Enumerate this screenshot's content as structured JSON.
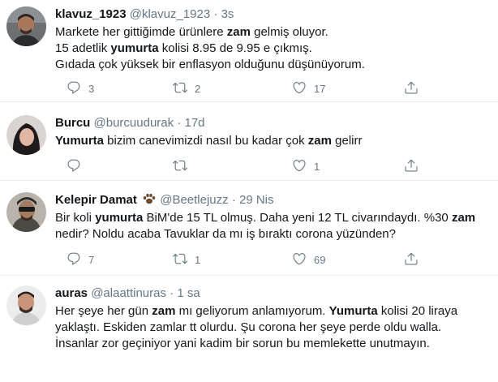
{
  "tweets": [
    {
      "name": "klavuz_1923",
      "handle": "@klavuz_1923",
      "separator": "·",
      "time": "3s",
      "lines": [
        [
          {
            "t": "Markete her gittiğimde ürünlere ",
            "b": false
          },
          {
            "t": "zam",
            "b": true
          },
          {
            "t": " gelmiş oluyor.",
            "b": false
          }
        ],
        [
          {
            "t": "15 adetlik ",
            "b": false
          },
          {
            "t": "yumurta",
            "b": true
          },
          {
            "t": " kolisi 8.95 de 9.95 e çıkmış.",
            "b": false
          }
        ],
        [
          {
            "t": "Gıdada çok yüksek bir enflasyon olduğunu düşünüyorum.",
            "b": false
          }
        ]
      ],
      "replies": "3",
      "retweets": "2",
      "likes": "17"
    },
    {
      "name": "Burcu",
      "handle": "@burcuudurak",
      "separator": "·",
      "time": "17d",
      "lines": [
        [
          {
            "t": "Yumurta",
            "b": true
          },
          {
            "t": " bizim canevimizdi nasıl bu kadar çok ",
            "b": false
          },
          {
            "t": "zam",
            "b": true
          },
          {
            "t": " gelirr",
            "b": false
          }
        ]
      ],
      "replies": "",
      "retweets": "",
      "likes": "1"
    },
    {
      "name": "Kelepir Damat",
      "has_paw": true,
      "handle": "@Beetlejuzz",
      "separator": "·",
      "time": "29 Nis",
      "lines": [
        [
          {
            "t": "Bir koli ",
            "b": false
          },
          {
            "t": "yumurta",
            "b": true
          },
          {
            "t": " BiM'de 15 TL olmuş. Daha yeni 12 TL civarındaydı. %30 ",
            "b": false
          },
          {
            "t": "zam",
            "b": true
          }
        ],
        [
          {
            "t": "nedir? Noldu acaba Tavuklar da mı iş bıraktı corona yüzünden?",
            "b": false
          }
        ]
      ],
      "replies": "7",
      "retweets": "1",
      "likes": "69"
    },
    {
      "name": "auras",
      "handle": "@alaattinuras",
      "separator": "·",
      "time": "1 sa",
      "lines": [
        [
          {
            "t": "Her şeye her gün ",
            "b": false
          },
          {
            "t": "zam",
            "b": true
          },
          {
            "t": " mı geliyorum anlamıyorum. ",
            "b": false
          },
          {
            "t": "Yumurta",
            "b": true
          },
          {
            "t": " kolisi 20 liraya",
            "b": false
          }
        ],
        [
          {
            "t": "yaklaştı. Eskiden zamlar tt olurdu. Şu corona her şeye perde oldu walla.",
            "b": false
          }
        ],
        [
          {
            "t": "İnsanlar zor geçiniyor yani kadim bir sorun bu memlekette unutmayın.",
            "b": false
          }
        ]
      ],
      "replies": "",
      "retweets": "",
      "likes": ""
    }
  ],
  "icons": {
    "reply": "reply-icon",
    "retweet": "retweet-icon",
    "like": "heart-icon",
    "share": "share-icon"
  },
  "colors": {
    "text": "#14171a",
    "secondary": "#657786",
    "divider": "#e6ecf0"
  }
}
